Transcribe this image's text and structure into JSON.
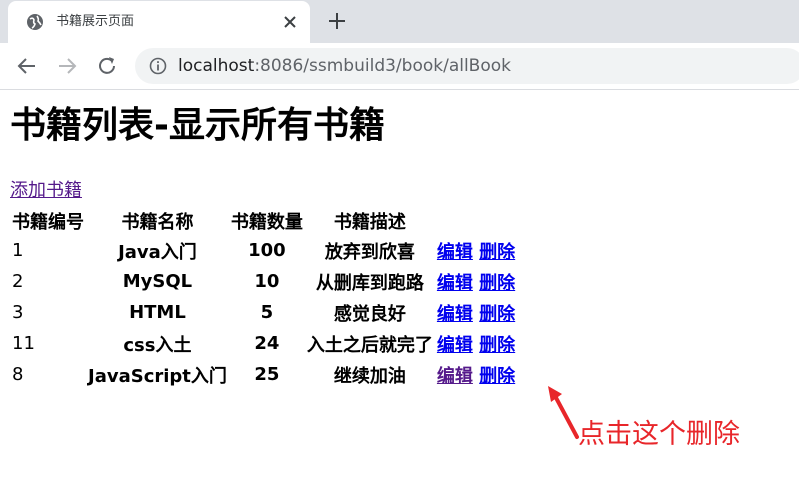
{
  "browser": {
    "tab_title": "书籍展示页面",
    "url_host": "localhost",
    "url_rest": ":8086/ssmbuild3/book/allBook"
  },
  "page": {
    "heading": "书籍列表-显示所有书籍",
    "add_link": "添加书籍",
    "columns": [
      "书籍编号",
      "书籍名称",
      "书籍数量",
      "书籍描述"
    ],
    "rows": [
      {
        "id": "1",
        "name": "Java入门",
        "count": "100",
        "desc": "放弃到欣喜",
        "edit": "编辑",
        "del": "删除"
      },
      {
        "id": "2",
        "name": "MySQL",
        "count": "10",
        "desc": "从删库到跑路",
        "edit": "编辑",
        "del": "删除"
      },
      {
        "id": "3",
        "name": "HTML",
        "count": "5",
        "desc": "感觉良好",
        "edit": "编辑",
        "del": "删除"
      },
      {
        "id": "11",
        "name": "css入土",
        "count": "24",
        "desc": "入土之后就完了",
        "edit": "编辑",
        "del": "删除"
      },
      {
        "id": "8",
        "name": "JavaScript入门",
        "count": "25",
        "desc": "继续加油",
        "edit": "编辑",
        "del": "删除"
      }
    ],
    "annotation": "点击这个删除"
  },
  "colors": {
    "annotation": "#e8262a",
    "link": "#0000ee",
    "visited_link": "#551a8b"
  },
  "icons": [
    "globe-icon",
    "close-icon",
    "plus-icon",
    "back-icon",
    "forward-icon",
    "reload-icon",
    "info-icon",
    "arrow-annotation"
  ]
}
